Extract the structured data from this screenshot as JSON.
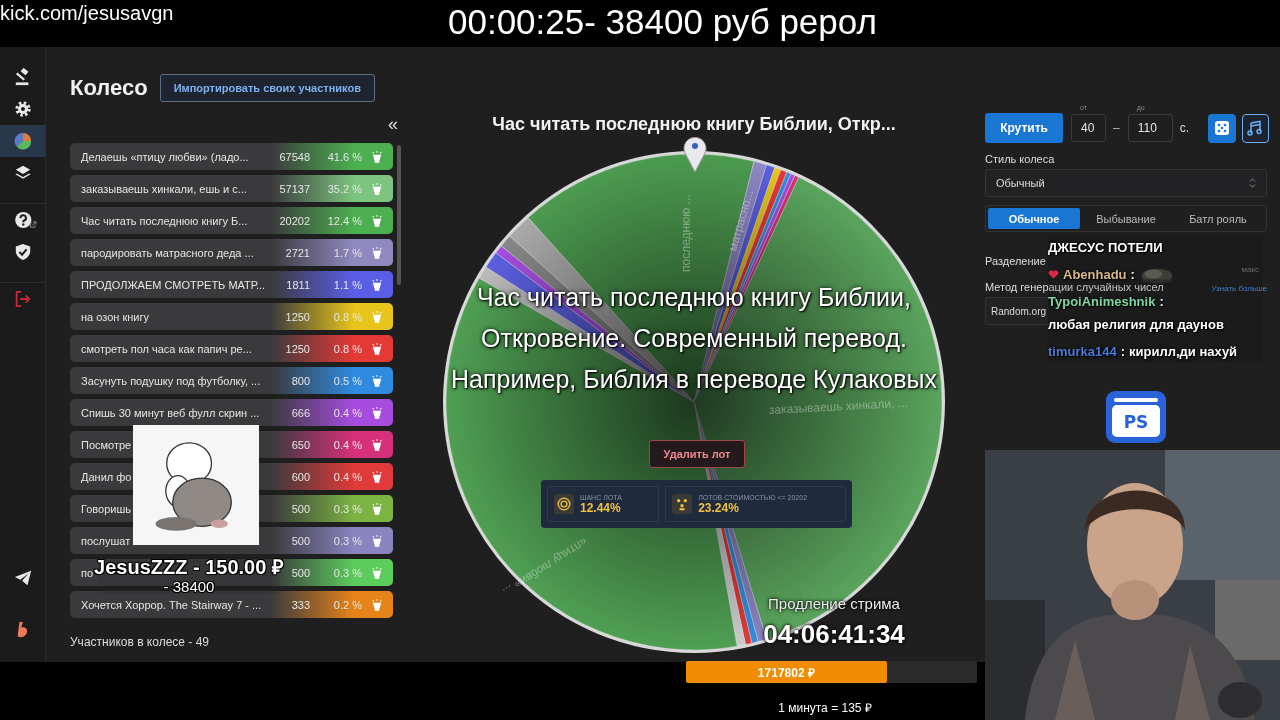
{
  "stream_overlay": {
    "url": "kick.com/jesusavgn",
    "header": "00:00:25- 38400 руб рерол"
  },
  "sidebar": {
    "items": [
      {
        "selected": false
      },
      {
        "selected": false
      },
      {
        "selected": true
      },
      {
        "selected": false
      },
      {
        "selected": false
      },
      {
        "selected": false
      },
      {
        "selected": false
      },
      {
        "selected": false
      },
      {
        "selected": false
      }
    ]
  },
  "participants": {
    "title": "Колесо",
    "import_button": "Импортировать своих участников",
    "collapse": "«",
    "rows": [
      {
        "name": "Делаешь «птицу любви» (ладо...",
        "amount": "67548",
        "percent": "41.6 %",
        "color": "#4caf50"
      },
      {
        "name": "заказываешь хинкали, ешь и с...",
        "amount": "57137",
        "percent": "35.2 %",
        "color": "#7cc47f"
      },
      {
        "name": "Час читать последнюю книгу Б...",
        "amount": "20202",
        "percent": "12.4 %",
        "color": "#4caf50"
      },
      {
        "name": "пародировать матрасного деда ...",
        "amount": "2721",
        "percent": "1.7 %",
        "color": "#9089c0"
      },
      {
        "name": "ПРОДОЛЖАЕМ СМОТРЕТЬ МАТР...",
        "amount": "1811",
        "percent": "1.1 %",
        "color": "#5a5ee6"
      },
      {
        "name": "на озон книгу",
        "amount": "1250",
        "percent": "0.8 %",
        "color": "#e8c51a"
      },
      {
        "name": "смотреть пол часа как папич ре...",
        "amount": "1250",
        "percent": "0.8 %",
        "color": "#e53935"
      },
      {
        "name": "Засунуть подушку под футболку, ...",
        "amount": "800",
        "percent": "0.5 %",
        "color": "#2f8be0"
      },
      {
        "name": "Спишь 30 минут веб фулл скрин ...",
        "amount": "666",
        "percent": "0.4 %",
        "color": "#a64de0"
      },
      {
        "name": "Посмотре",
        "amount": "650",
        "percent": "0.4 %",
        "color": "#d6307a"
      },
      {
        "name": "Данил фо",
        "amount": "600",
        "percent": "0.4 %",
        "color": "#e03a3a"
      },
      {
        "name": "Говоришь",
        "amount": "500",
        "percent": "0.3 %",
        "color": "#7cb342"
      },
      {
        "name": "послушат",
        "amount": "500",
        "percent": "0.3 %",
        "color": "#8a84c0"
      },
      {
        "name": "по",
        "amount": "500",
        "percent": "0.3 %",
        "color": "#5ccc5c"
      },
      {
        "name": "Хочется Хоррор. The Stairway 7 - ...",
        "amount": "333",
        "percent": "0.2 %",
        "color": "#e6841a"
      }
    ],
    "footer": "Участников в колесе - 49"
  },
  "wheel": {
    "title": "Час читать последнюю книгу Библии, Откр...",
    "slice_labels": [
      {
        "text": "последнюю ..."
      },
      {
        "text": "матрасно..."
      },
      {
        "text": "заказываешь хинкали, ..."
      },
      {
        "text": "«птицу любви» ..."
      }
    ],
    "winner_text": "Час читать последнюю книгу Библии, Откровение. Современный перевод. Например, Библия в переводе Кулаковых",
    "delete_button": "Удалить лот",
    "stats": [
      {
        "label": "ШАНС ЛОТА",
        "value": "12.44%"
      },
      {
        "label": "ЛОТОВ СТОИМОСТЬЮ <= 20202",
        "value": "23.24%"
      }
    ]
  },
  "controls": {
    "spin_button": "Крутить",
    "from": {
      "label": "от",
      "value": "40"
    },
    "dash": "–",
    "to": {
      "label": "до",
      "value": "110"
    },
    "unit": "с.",
    "style_label": "Стиль колеса",
    "style_value": "Обычный",
    "modes": [
      {
        "label": "Обычное",
        "selected": true
      },
      {
        "label": "Выбывание",
        "selected": false
      },
      {
        "label": "Батл рояль",
        "selected": false
      }
    ],
    "split_label": "Разделение",
    "split_max": "макс",
    "rng_label": "Метод генерации случайных чисел",
    "learn_more": "Узнать больше",
    "rng_value": "Random.org"
  },
  "chat": {
    "messages": [
      {
        "kind": "text",
        "text": "ДЖЕСУС ПОТЕЛИ",
        "badge": false
      },
      {
        "kind": "emote",
        "user": "Abenhadu",
        "separator": ":",
        "color": "#d9b98a",
        "badge": true
      },
      {
        "kind": "text",
        "user": "TypoiAnimeshnik",
        "separator": ":",
        "color": "#7fd6a0",
        "text": "любая религия для даунов",
        "badge": false
      },
      {
        "kind": "text",
        "user": "timurka144",
        "separator": ":",
        "color": "#4a7ad8",
        "text": "кирилл,ди нахуй",
        "badge": false
      }
    ]
  },
  "wallet": {
    "label": "PS"
  },
  "stream": {
    "extension_label": "Продление стрима",
    "timer": "04:06:41:34",
    "goal": {
      "amount": "1717802 ₽",
      "level": 0.69
    },
    "rate": "1 минута = 135 ₽",
    "donation": {
      "lines": [
        "JesusZZZ - 150.00 ₽",
        "- 38400"
      ]
    }
  }
}
